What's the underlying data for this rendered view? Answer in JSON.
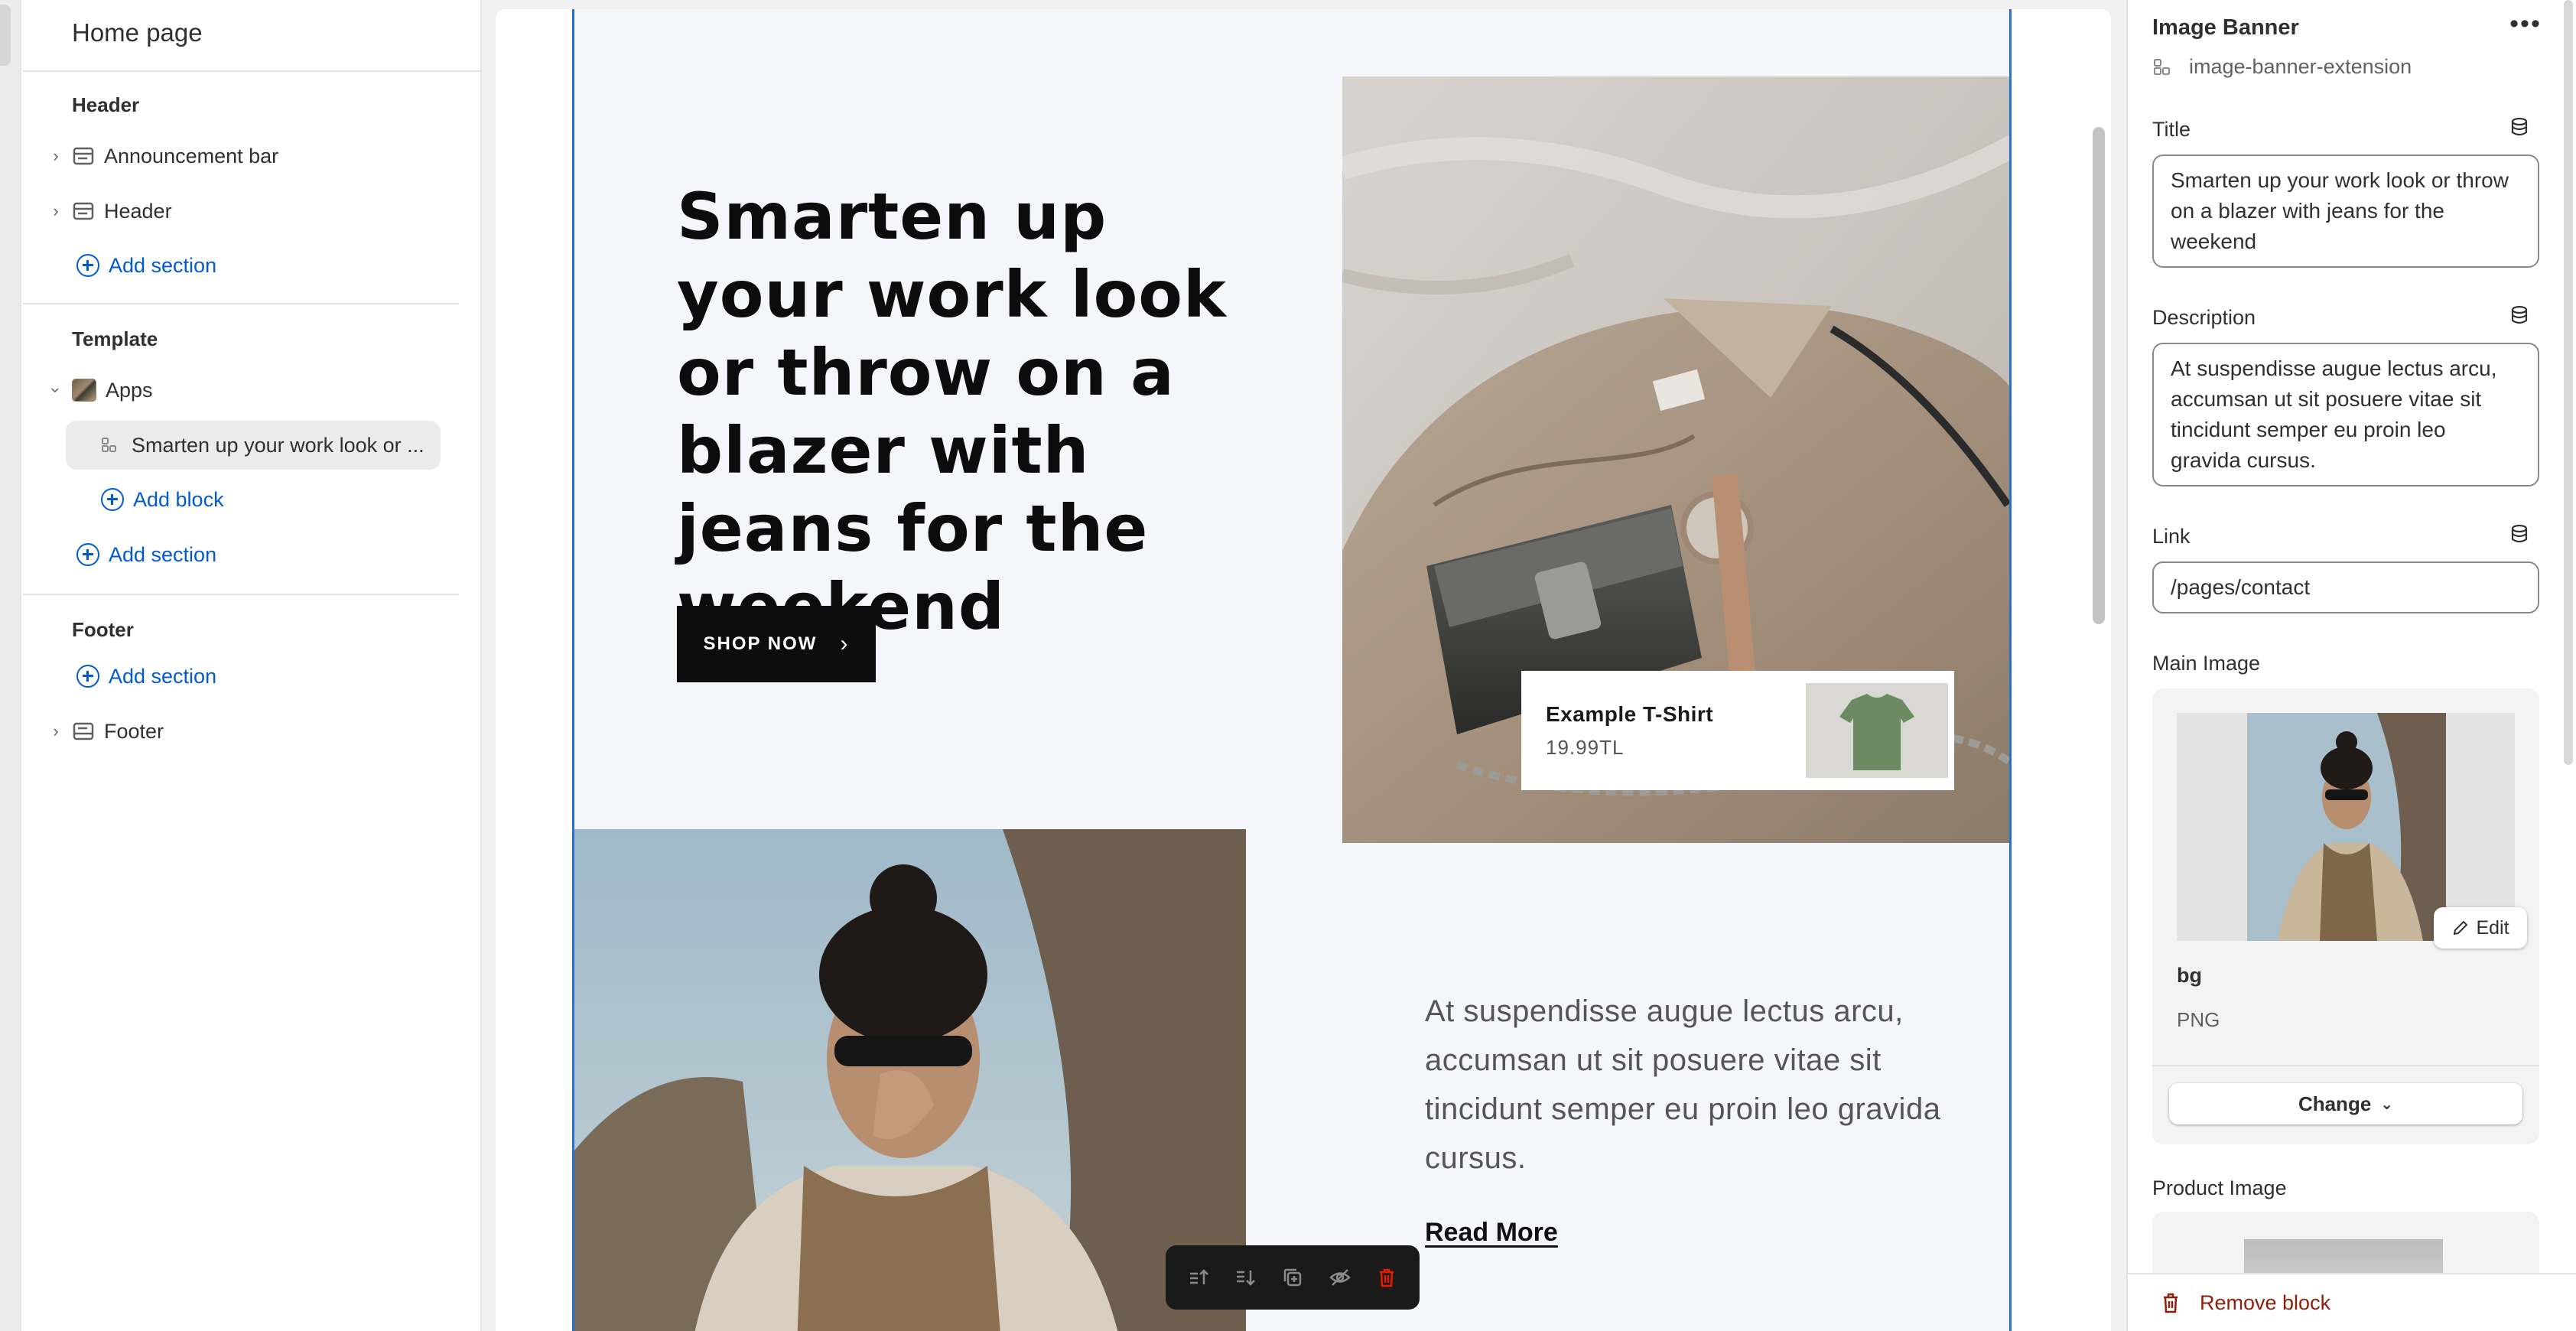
{
  "left_panel": {
    "title": "Home page",
    "header_group": {
      "title": "Header",
      "items": [
        "Announcement bar",
        "Header"
      ],
      "add_section": "Add section"
    },
    "template_group": {
      "title": "Template",
      "app_item": "Apps",
      "selected_block": "Smarten up your work look or ...",
      "add_block": "Add block",
      "add_section": "Add section"
    },
    "footer_group": {
      "title": "Footer",
      "add_section": "Add section",
      "items": [
        "Footer"
      ]
    }
  },
  "preview": {
    "hero_title": "Smarten up your work look or throw on a blazer with jeans for the weekend",
    "button_label": "SHOP NOW",
    "product": {
      "name": "Example T-Shirt",
      "price": "19.99TL"
    },
    "description": "At suspendisse augue lectus arcu, accumsan ut sit posuere vitae sit tincidunt semper eu proin leo gravida cursus.",
    "link_label": "Read More"
  },
  "block_toolbar": [
    "move-up-icon",
    "move-down-icon",
    "duplicate-icon",
    "hide-icon",
    "delete-icon"
  ],
  "right_panel": {
    "title": "Image Banner",
    "extension": "image-banner-extension",
    "fields": {
      "title": {
        "label": "Title",
        "value": "Smarten up your work look or throw on a blazer with jeans for the weekend"
      },
      "description": {
        "label": "Description",
        "value": "At suspendisse augue lectus arcu, accumsan ut sit posuere vitae sit tincidunt semper eu proin leo gravida cursus."
      },
      "link": {
        "label": "Link",
        "value": "/pages/contact"
      }
    },
    "main_image": {
      "label": "Main Image",
      "name": "bg",
      "type": "PNG",
      "edit_label": "Edit",
      "change_label": "Change"
    },
    "product_image": {
      "label": "Product Image"
    },
    "remove_label": "Remove block"
  },
  "colors": {
    "accent_blue": "#005bd3",
    "selection_outline": "#2c6ecb",
    "critical": "#8e1f0b",
    "preview_bg": "#f5f6fa"
  }
}
